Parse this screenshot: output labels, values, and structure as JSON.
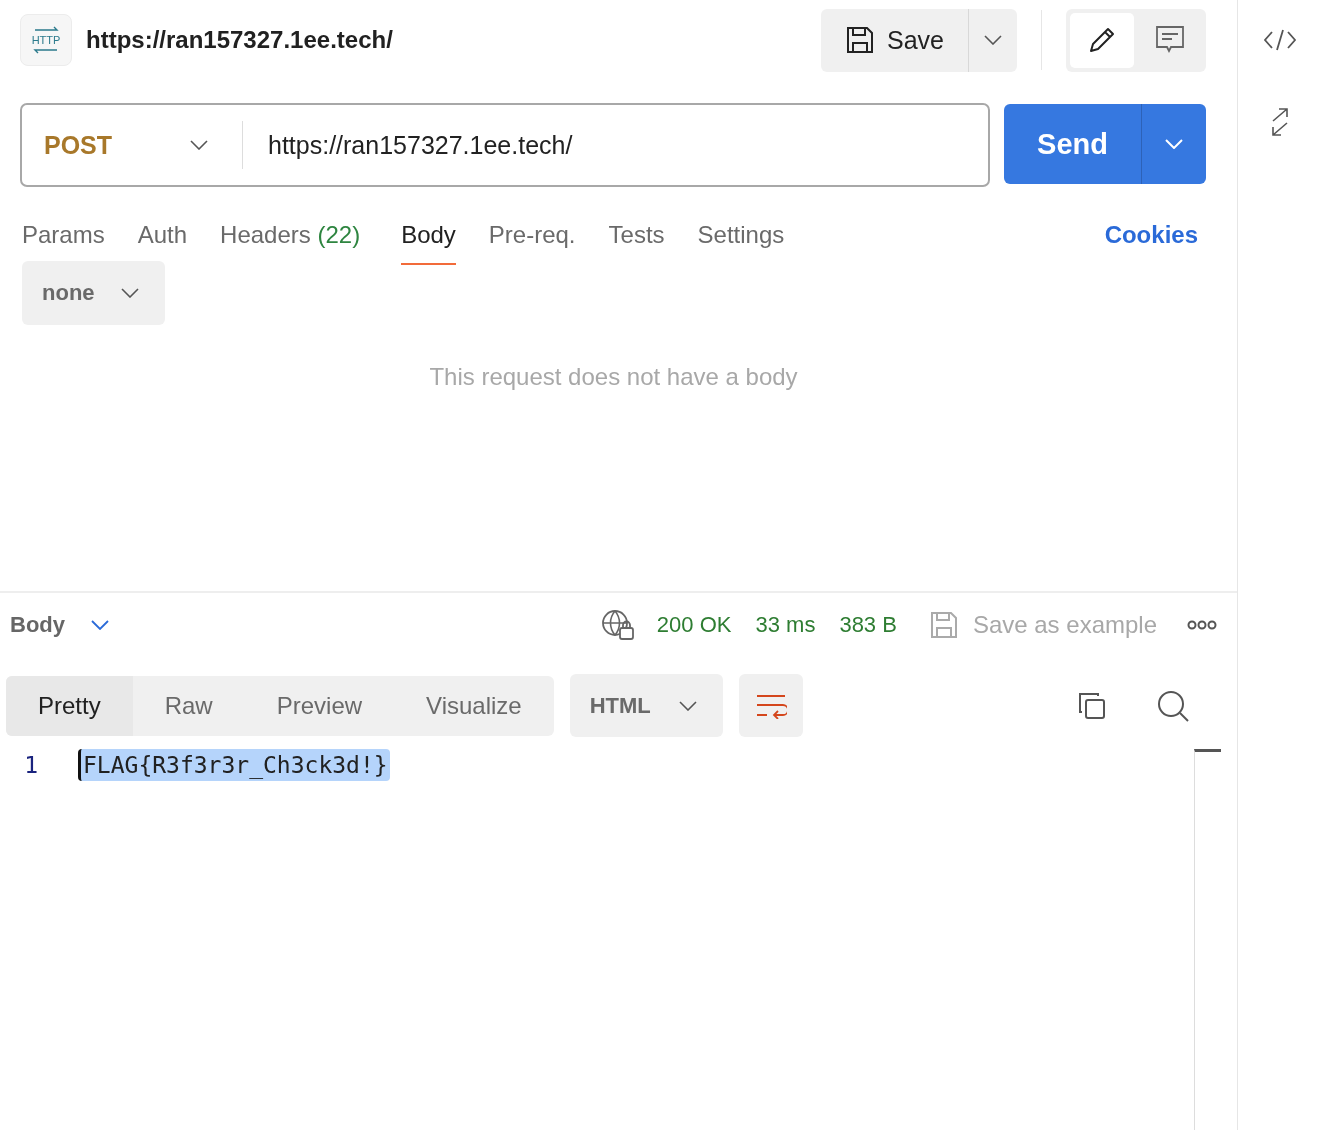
{
  "header": {
    "logo_text": "HTTP",
    "title": "https://ran157327.1ee.tech/",
    "save_label": "Save",
    "modes": [
      {
        "kind": "edit",
        "selected": true
      },
      {
        "kind": "comment",
        "selected": false
      }
    ]
  },
  "request": {
    "method": "POST",
    "url": "https://ran157327.1ee.tech/",
    "send_label": "Send"
  },
  "tabs": [
    {
      "label": "Params",
      "selected": false
    },
    {
      "label": "Auth",
      "selected": false
    },
    {
      "label": "Headers",
      "count": "(22)",
      "selected": false
    },
    {
      "label": "Body",
      "selected": true
    },
    {
      "label": "Pre-req.",
      "selected": false
    },
    {
      "label": "Tests",
      "selected": false
    },
    {
      "label": "Settings",
      "selected": false
    }
  ],
  "cookies_link": "Cookies",
  "body_type": "none",
  "empty_message": "This request does not have a body",
  "response": {
    "section": "Body",
    "status": "200 OK",
    "time": "33 ms",
    "size": "383 B",
    "save_example": "Save as example",
    "views": [
      {
        "label": "Pretty",
        "selected": true
      },
      {
        "label": "Raw",
        "selected": false
      },
      {
        "label": "Preview",
        "selected": false
      },
      {
        "label": "Visualize",
        "selected": false
      }
    ],
    "format": "HTML",
    "wrap": true,
    "lines": [
      {
        "number": "1",
        "text": "FLAG{R3f3r3r_Ch3ck3d!}",
        "selected": true
      }
    ]
  }
}
